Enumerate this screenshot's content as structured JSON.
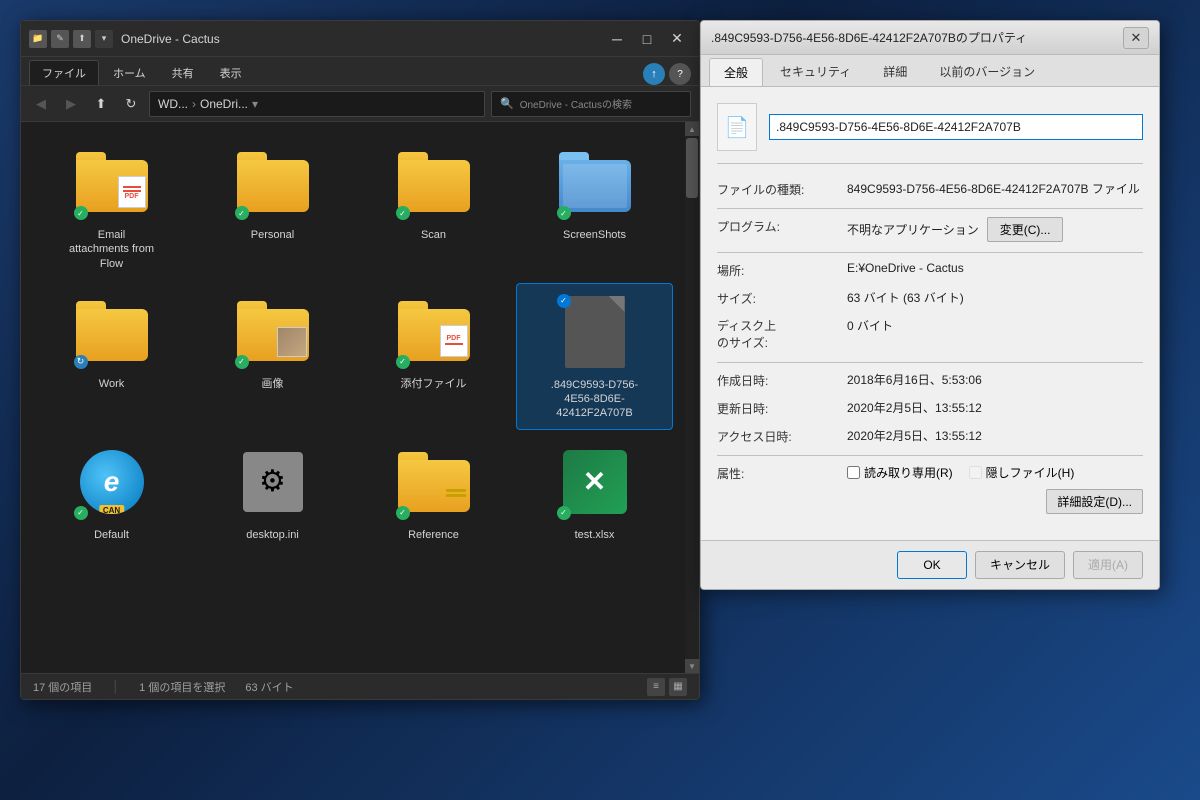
{
  "explorer": {
    "title": "OneDrive - Cactus",
    "title_full": "OneDrive - Cactus",
    "tabs": [
      "ファイル",
      "ホーム",
      "共有",
      "表示"
    ],
    "active_tab": "ファイル",
    "nav": {
      "path_parts": [
        "WD...",
        "OneDri..."
      ],
      "search_placeholder": "OneDrive - Cactusの検索"
    },
    "files": [
      {
        "name": "Email attachments from Flow",
        "type": "folder",
        "sync": "green"
      },
      {
        "name": "Personal",
        "type": "folder",
        "sync": "green"
      },
      {
        "name": "Scan",
        "type": "folder",
        "sync": "green"
      },
      {
        "name": "ScreenShots",
        "type": "folder-special",
        "sync": "green"
      },
      {
        "name": "Work",
        "type": "folder",
        "sync": "blue"
      },
      {
        "name": "画像",
        "type": "folder-image",
        "sync": "green"
      },
      {
        "name": "添付ファイル",
        "type": "folder-pdf",
        "sync": "green"
      },
      {
        "name": ".849C9593-D756-4E56-8D6E-42412F2A707B",
        "type": "gray-file",
        "sync": "none",
        "selected": true
      },
      {
        "name": "Default",
        "type": "edge",
        "sync": "green"
      },
      {
        "name": "desktop.ini",
        "type": "gear",
        "sync": "none"
      },
      {
        "name": "Reference",
        "type": "folder-ref",
        "sync": "green"
      },
      {
        "name": "test.xlsx",
        "type": "excel",
        "sync": "green"
      }
    ],
    "status": {
      "total": "17 個の項目",
      "selected": "1 個の項目を選択",
      "size": "63 バイト"
    }
  },
  "properties": {
    "title": ".849C9593-D756-4E56-8D6E-42412F2A707Bのプロパティ",
    "tabs": [
      "全般",
      "セキュリティ",
      "詳細",
      "以前のバージョン"
    ],
    "active_tab": "全般",
    "filename": ".849C9593-D756-4E56-8D6E-42412F2A707B",
    "rows": [
      {
        "label": "ファイルの種類:",
        "value": "849C9593-D756-4E56-8D6E-42412F2A707B ファイル"
      },
      {
        "label": "プログラム:",
        "value": "不明なアプリケーション",
        "has_button": true,
        "button_label": "変更(C)..."
      },
      {
        "label": "場所:",
        "value": "E:¥OneDrive - Cactus"
      },
      {
        "label": "サイズ:",
        "value": "63 バイト (63 バイト)"
      },
      {
        "label": "ディスク上\nのサイズ:",
        "value": "0 バイト"
      },
      {
        "label": "作成日時:",
        "value": "2018年6月16日、5:53:06"
      },
      {
        "label": "更新日時:",
        "value": "2020年2月5日、13:55:12"
      },
      {
        "label": "アクセス日時:",
        "value": "2020年2月5日、13:55:12"
      }
    ],
    "attributes": {
      "label": "属性:",
      "readonly_label": "読み取り専用(R)",
      "readonly_checked": false,
      "hidden_label": "隠しファイル(H)",
      "hidden_checked": false,
      "advanced_label": "詳細設定(D)..."
    },
    "buttons": {
      "ok": "OK",
      "cancel": "キャンセル",
      "apply": "適用(A)"
    }
  }
}
